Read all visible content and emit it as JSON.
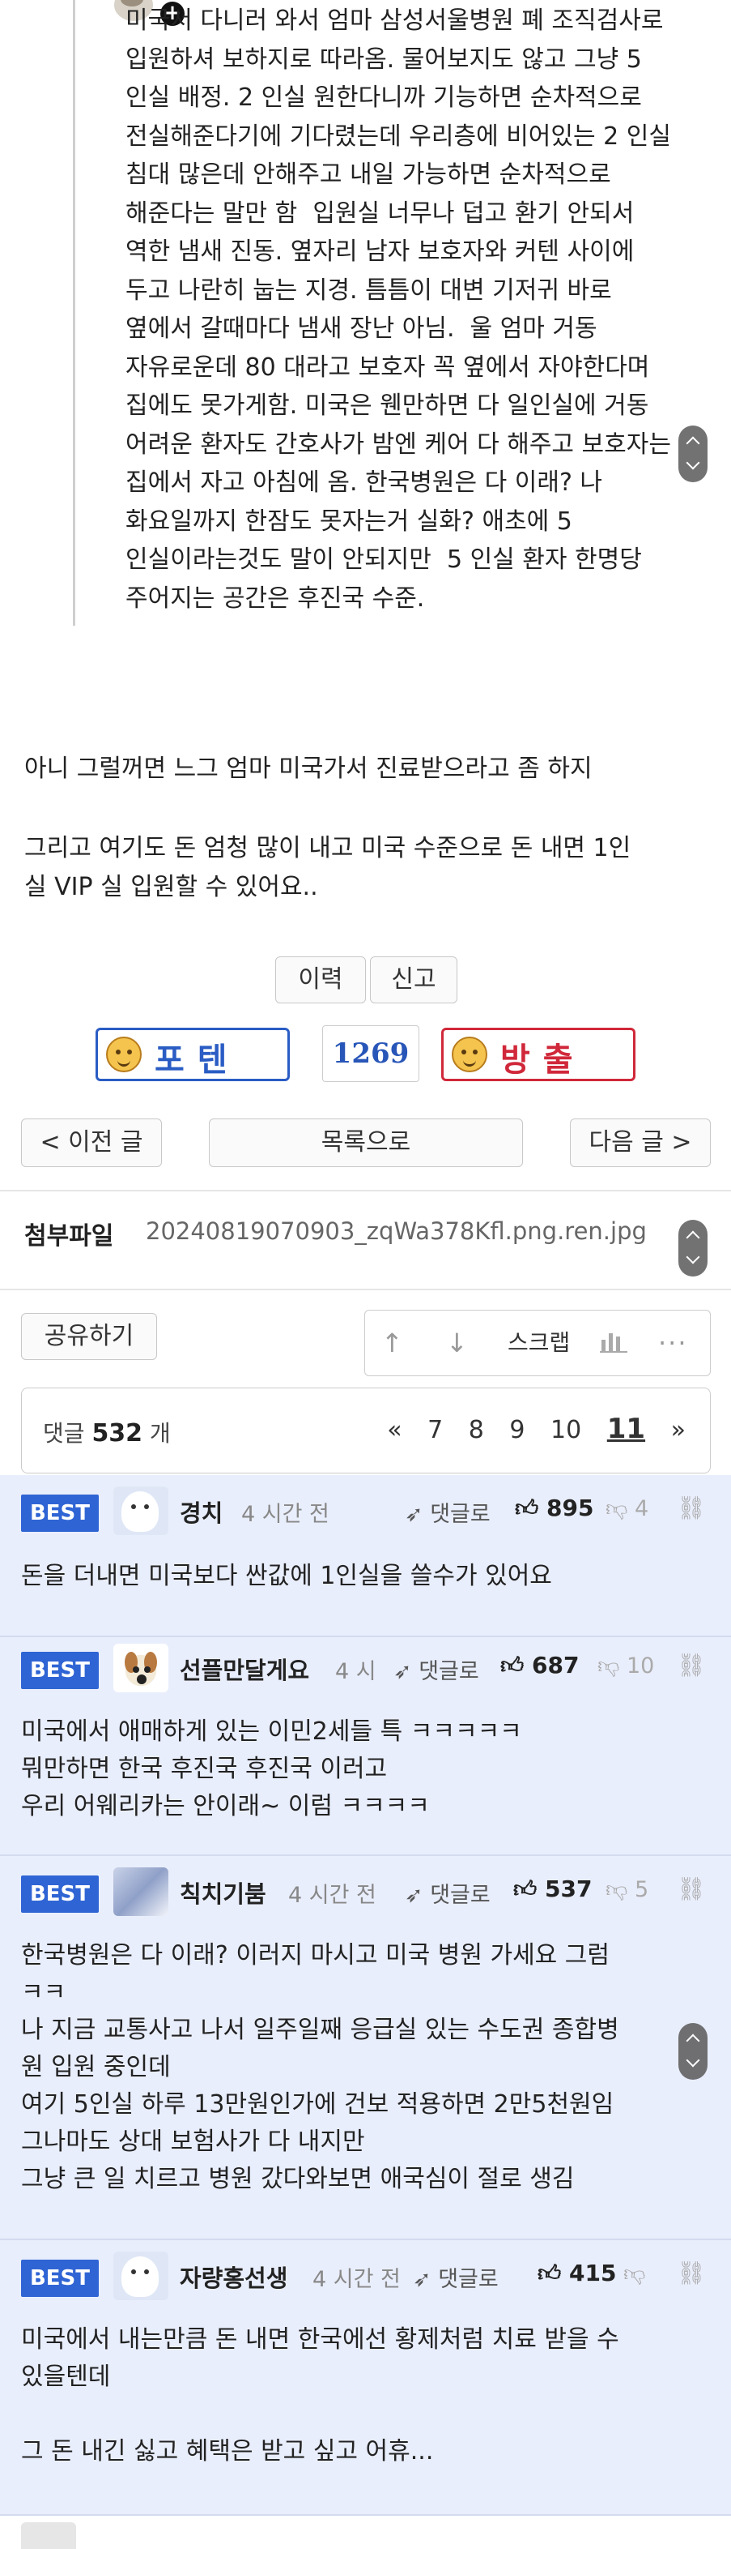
{
  "quote": {
    "text": "미국서 다니러 와서 엄마 삼성서울병원 폐 조직검사로\n입원하셔 보하지로 따라옴. 물어보지도 않고 그냥 5\n인실 배정. 2 인실 원한다니까 기능하면 순차적으로\n전실해준다기에 기다렸는데 우리층에 비어있는 2 인실\n침대 많은데 안해주고 내일 가능하면 순차적으로\n해준다는 말만 함  입원실 너무나 덥고 환기 안되서\n역한 냄새 진동. 옆자리 남자 보호자와 커텐 사이에\n두고 나란히 눕는 지경. 틈틈이 대변 기저귀 바로\n옆에서 갈때마다 냄새 장난 아님.  울 엄마 거동\n자유로운데 80 대라고 보호자 꼭 옆에서 자야한다며\n집에도 못가게함. 미국은 웬만하면 다 일인실에 거동\n어려운 환자도 간호사가 밤엔 케어 다 해주고 보호자는\n집에서 자고 아침에 옴. 한국병원은 다 이래? 나\n화요일까지 한잠도 못자는거 실화? 애초에 5\n인실이라는것도 말이 안되지만  5 인실 환자 한명당\n주어지는 공간은 후진국 수준."
  },
  "post": {
    "line1": "아니 그럴꺼면 느그 엄마 미국가서 진료받으라고 좀 하지",
    "line2": "그리고 여기도 돈 엄청 많이 내고 미국 수준으로 돈 내면 1인",
    "line3": "실 VIP 실 입원할 수 있어요.."
  },
  "actions": {
    "history": "이력",
    "report": "신고",
    "upvote": "포텐",
    "downvote": "방출",
    "vote_count": "1269",
    "prev": "< 이전 글",
    "list": "목록으로",
    "next": "다음 글 >"
  },
  "attachment": {
    "label": "첨부파일",
    "filename": "20240819070903_zqWa378Kfl.png.ren.jpg"
  },
  "toolbar": {
    "share": "공유하기",
    "scrap": "스크랩",
    "icons": [
      "arrow-up-icon",
      "arrow-down-icon",
      "bar-chart-icon",
      "more-icon"
    ]
  },
  "comments_header": {
    "prefix": "댓글",
    "count": "532",
    "suffix": "개",
    "pager_first": "«",
    "pages": [
      "7",
      "8",
      "9",
      "10",
      "11"
    ],
    "current": "11",
    "pager_last": "»"
  },
  "comments": [
    {
      "badge": "BEST",
      "nick": "경치",
      "time": "4 시간 전",
      "reply": "댓글로",
      "likes": "895",
      "dislikes": "4",
      "body": "돈을 더내면 미국보다 싼값에 1인실을 쓸수가 있어요"
    },
    {
      "badge": "BEST",
      "nick": "선플만달게요",
      "time": "4 시",
      "reply": "댓글로",
      "likes": "687",
      "dislikes": "10",
      "body": "미국에서 애매하게 있는 이민2세들 특 ㅋㅋㅋㅋㅋ\n뭐만하면 한국 후진국 후진국 이러고\n우리 어웨리카는 안이래~ 이럼 ㅋㅋㅋㅋ"
    },
    {
      "badge": "BEST",
      "nick": "칙치기붐",
      "time": "4 시간 전",
      "reply": "댓글로",
      "likes": "537",
      "dislikes": "5",
      "body": "한국병원은 다 이래? 이러지 마시고 미국 병원 가세요 그럼\nㅋㅋ\n나 지금 교통사고 나서 일주일째 응급실 있는 수도권 종합병\n원 입원 중인데\n여기 5인실 하루 13만원인가에 건보 적용하면 2만5천원임\n그나마도 상대 보험사가 다 내지만\n그냥 큰 일 치르고 병원 갔다와보면 애국심이 절로 생김"
    },
    {
      "badge": "BEST",
      "nick": "자량홍선생",
      "time": "4 시간 전",
      "reply": "댓글로",
      "likes": "415",
      "dislikes": "",
      "body": "미국에서 내는만큼 돈 내면 한국에선 황제처럼 치료 받을 수\n있을텐데\n\n그 돈 내긴 싫고 혜택은 받고 싶고 어휴..."
    }
  ],
  "colors": {
    "best_badge": "#2f64d4",
    "comment_bg": "#e9eefc",
    "upvote_border": "#2a5cc4",
    "downvote_border": "#d0283a",
    "vote_count": "#2856b8"
  }
}
